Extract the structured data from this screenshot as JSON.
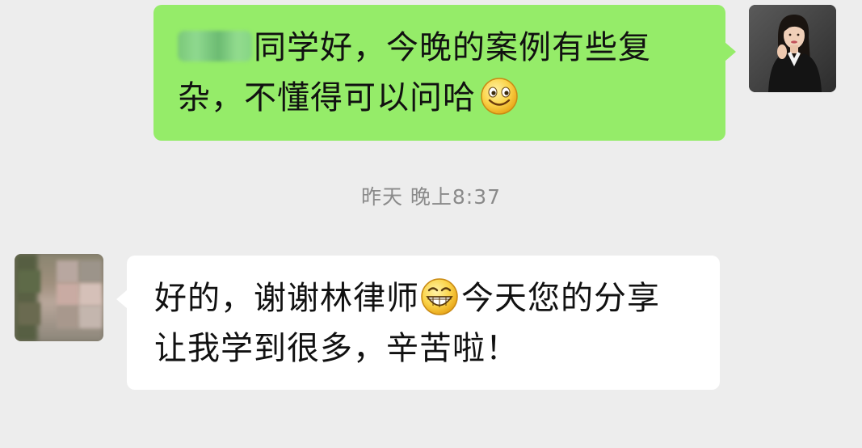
{
  "conversation": {
    "messages": [
      {
        "direction": "outgoing",
        "sender_name_redacted": true,
        "line1": "同学好，今晚的案例有些复",
        "line2": "杂，不懂得可以问哈",
        "emoji": "smile-emoji"
      },
      {
        "direction": "incoming",
        "line1_before_emoji": "好的，谢谢林律师",
        "emoji": "grin-emoji",
        "line1_after_emoji": "今天您的分享",
        "line2": "让我学到很多，辛苦啦！"
      }
    ],
    "timestamp": "昨天 晚上8:37"
  },
  "colors": {
    "background": "#ededed",
    "outgoing_bubble": "#95ec69",
    "incoming_bubble": "#ffffff",
    "timestamp_text": "#8a8a8a",
    "message_text": "#111111"
  }
}
